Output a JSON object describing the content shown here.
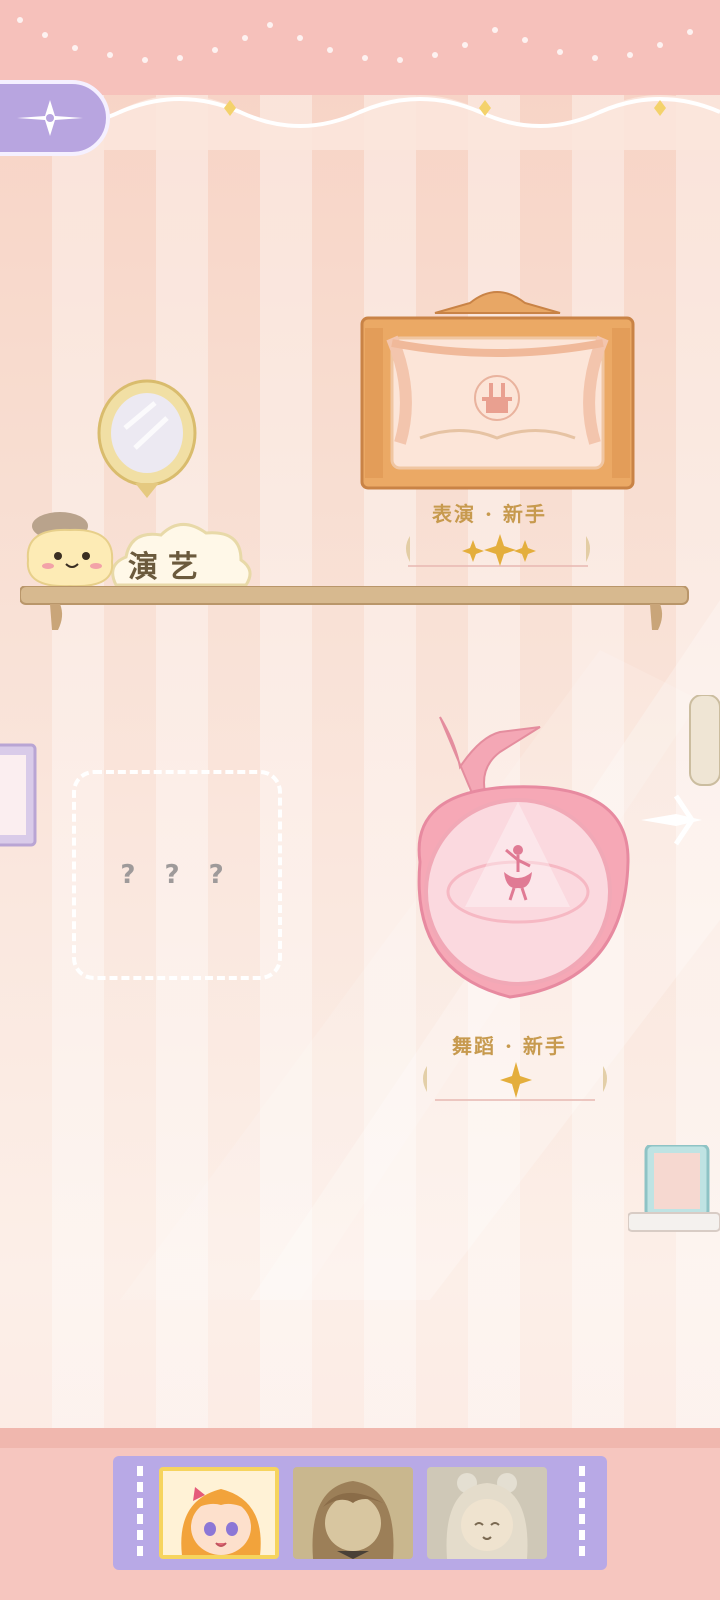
{
  "header": {
    "back_icon": "compass-star-icon"
  },
  "shelf": {
    "tag_label": "演艺"
  },
  "skills": [
    {
      "title": "表演 · 新手",
      "stars": 3,
      "icon": "magic-hat-rabbit-icon"
    },
    {
      "title": "舞蹈 · 新手",
      "stars": 1,
      "icon": "ballerina-icon"
    }
  ],
  "locked_slot": {
    "label": "? ? ?"
  },
  "characters": [
    {
      "name": "avatar-girl-orange-hair",
      "selected": true
    },
    {
      "name": "avatar-boy-brown-hair",
      "selected": false
    },
    {
      "name": "avatar-girl-white-hair",
      "selected": false
    }
  ],
  "colors": {
    "accent_gold": "#c79a4e",
    "purple": "#b8a9e6",
    "pink_frame": "#f2aab6"
  }
}
